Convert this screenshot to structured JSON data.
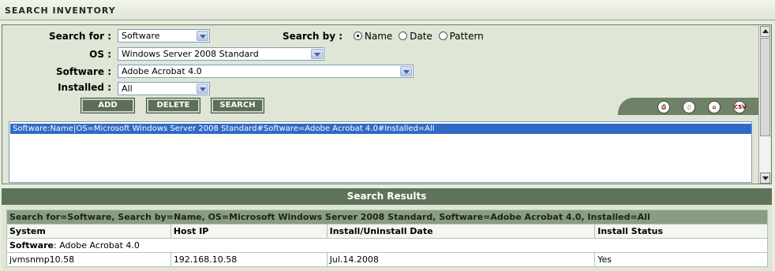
{
  "title": "SEARCH INVENTORY",
  "form": {
    "search_for_label": "Search for :",
    "search_for_value": "Software",
    "os_label": "OS :",
    "os_value": "Windows Server 2008 Standard",
    "software_label": "Software :",
    "software_value": "Adobe Acrobat 4.0",
    "installed_label": "Installed :",
    "installed_value": "All",
    "search_by_label": "Search by :",
    "search_by_options": [
      "Name",
      "Date",
      "Pattern"
    ],
    "search_by_selected": "Name"
  },
  "buttons": {
    "add": "ADD",
    "delete": "DELETE",
    "search": "SEARCH"
  },
  "icons": [
    "print-icon",
    "pdf-icon",
    "home-icon",
    "csv-icon"
  ],
  "icon_labels": {
    "csv": "CSV"
  },
  "query_list": [
    "Software:Name|OS=Microsoft Windows Server 2008 Standard#Software=Adobe Acrobat 4.0#Installed=All"
  ],
  "results": {
    "header": "Search Results",
    "summary": "Search for=Software, Search by=Name, OS=Microsoft Windows Server 2008 Standard, Software=Adobe Acrobat 4.0, Installed=All",
    "columns": [
      "System",
      "Host IP",
      "Install/Uninstall Date",
      "Install Status"
    ],
    "group_label": "Software",
    "group_value": ": Adobe Acrobat 4.0",
    "rows": [
      {
        "system": "jvmsnmp10.58",
        "host_ip": "192.168.10.58",
        "date": "Jul.14.2008",
        "status": "Yes"
      }
    ]
  },
  "colors": {
    "accent_green": "#5f7359",
    "selection_blue": "#316ac5"
  }
}
